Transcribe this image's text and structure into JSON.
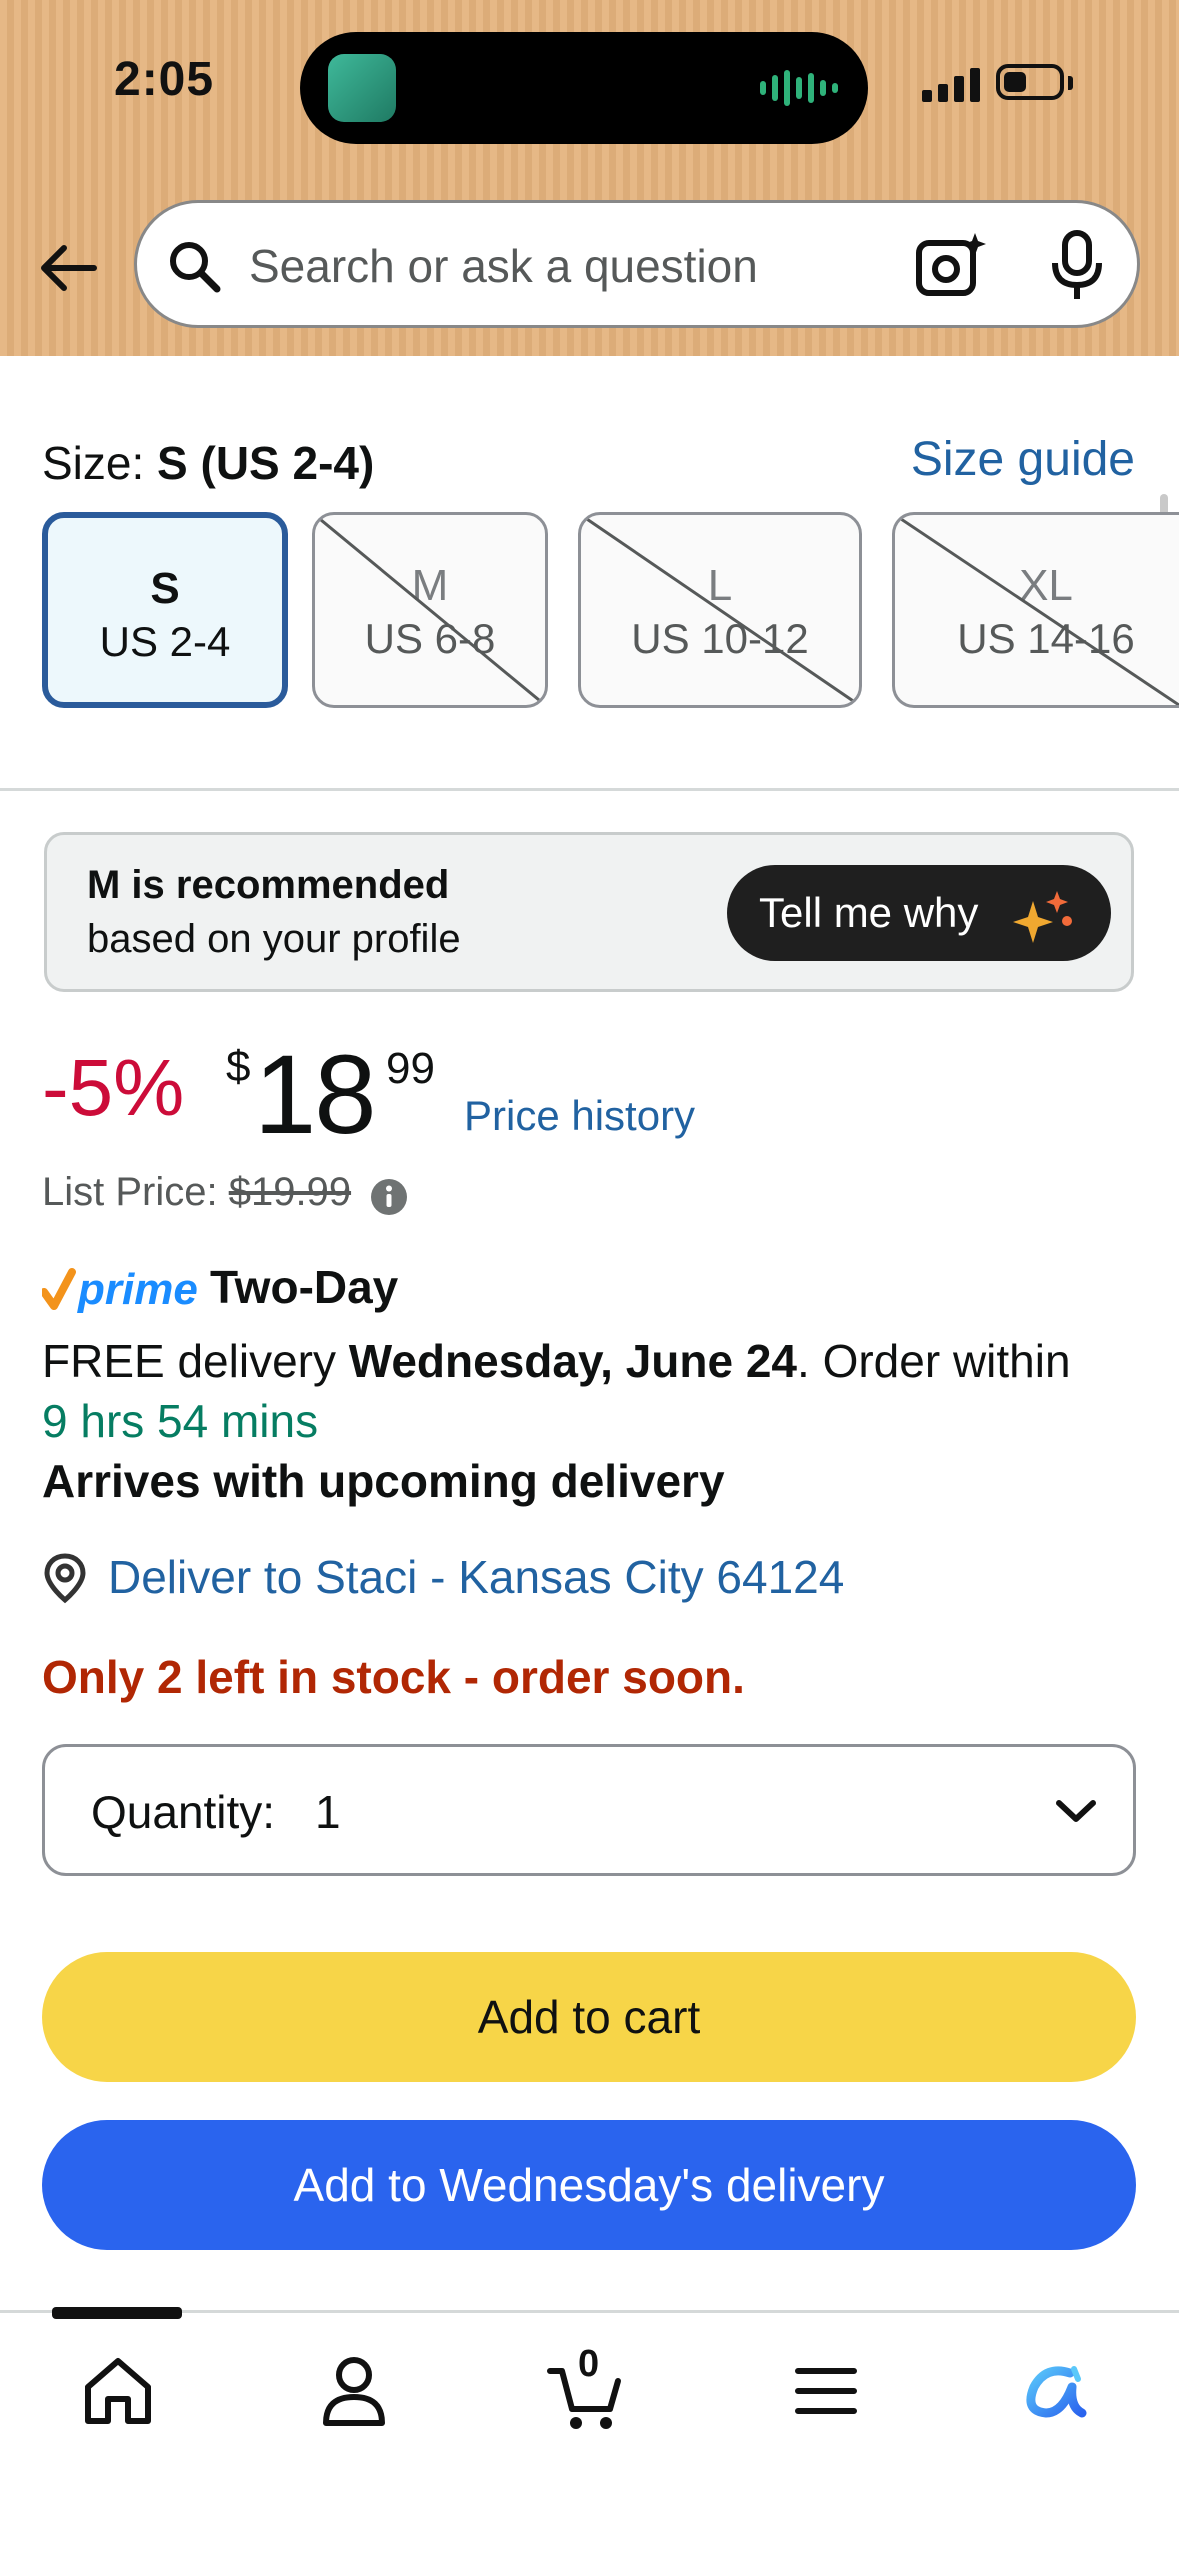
{
  "status_bar": {
    "time": "2:05"
  },
  "search": {
    "placeholder": "Search or ask a question"
  },
  "size": {
    "label_prefix": "Size: ",
    "label_value": "S (US 2-4)",
    "guide_link": "Size guide",
    "options": [
      {
        "size": "S",
        "us": "US 2-4",
        "selected": true,
        "available": true
      },
      {
        "size": "M",
        "us": "US 6-8",
        "selected": false,
        "available": false
      },
      {
        "size": "L",
        "us": "US 10-12",
        "selected": false,
        "available": false
      },
      {
        "size": "XL",
        "us": "US 14-16",
        "selected": false,
        "available": false
      }
    ]
  },
  "recommendation": {
    "line1": "M is recommended",
    "line2": "based on your profile",
    "button": "Tell me why"
  },
  "price": {
    "discount": "-5%",
    "currency": "$",
    "whole": "18",
    "fraction": "99",
    "history_link": "Price history",
    "list_label": "List Price: ",
    "list_value": "$19.99"
  },
  "delivery": {
    "prime_word": "prime",
    "prime_badge": "Two-Day",
    "free_prefix": "FREE delivery ",
    "date": "Wednesday, June 24",
    "order_within": ". Order within",
    "countdown": "9 hrs 54 mins",
    "arrives": "Arrives with upcoming delivery",
    "deliver_to": "Deliver to Staci - Kansas City 64124"
  },
  "stock": "Only 2 left in stock - order soon.",
  "quantity": {
    "label": "Quantity:",
    "value": "1"
  },
  "buttons": {
    "add_to_cart": "Add to cart",
    "add_to_delivery": "Add to Wednesday's delivery"
  },
  "tabbar": {
    "cart_count": "0",
    "tabs": [
      "home-icon",
      "account-icon",
      "cart-icon",
      "menu-icon",
      "rufus-icon"
    ]
  },
  "colors": {
    "header": "#e6b886",
    "link": "#2162a1",
    "discount": "#cc0c39",
    "countdown": "#067d62",
    "stock": "#b12704",
    "add_to_cart": "#f7d548",
    "add_to_delivery": "#2a64ee",
    "selected_border": "#2a5b9b"
  }
}
